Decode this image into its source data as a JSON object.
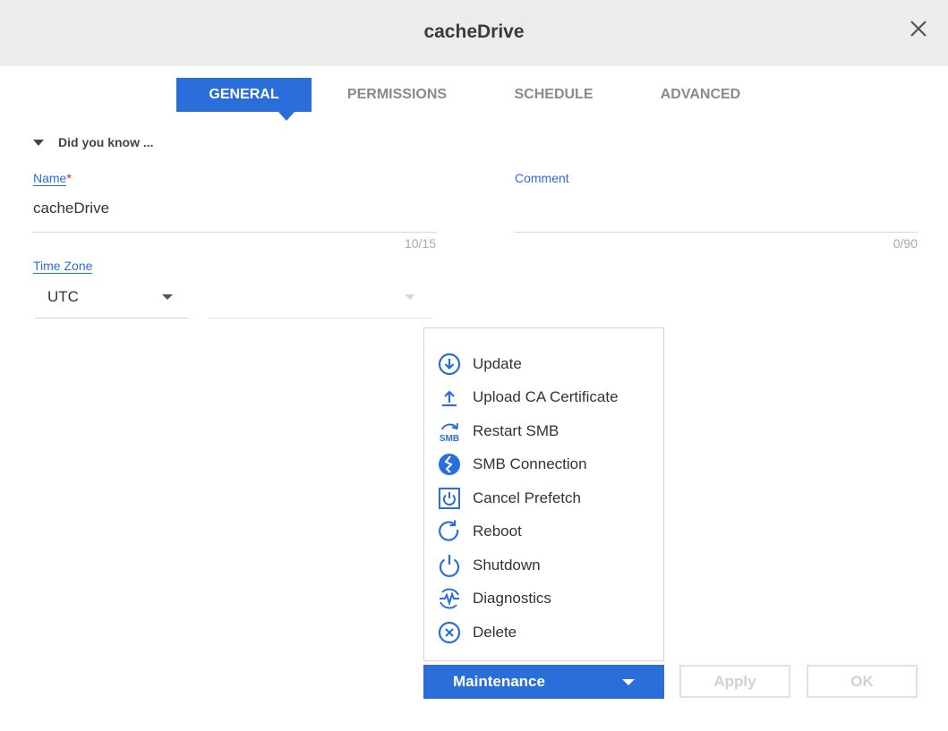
{
  "dialog": {
    "title": "cacheDrive",
    "close_icon": "close-icon"
  },
  "tabs": [
    {
      "label": "GENERAL",
      "active": true
    },
    {
      "label": "PERMISSIONS",
      "active": false
    },
    {
      "label": "SCHEDULE",
      "active": false
    },
    {
      "label": "ADVANCED",
      "active": false
    }
  ],
  "did_you_know": "Did you know ...",
  "form": {
    "name": {
      "label": "Name",
      "required_mark": "*",
      "value": "cacheDrive",
      "counter": "10/15"
    },
    "comment": {
      "label": "Comment",
      "value": "",
      "counter": "0/90"
    },
    "time_zone": {
      "label": "Time Zone",
      "value": "UTC",
      "secondary_value": ""
    }
  },
  "maintenance_menu": {
    "items": [
      {
        "label": "Update",
        "icon": "update-icon"
      },
      {
        "label": "Upload CA Certificate",
        "icon": "upload-icon"
      },
      {
        "label": "Restart SMB",
        "icon": "restart-smb-icon",
        "icon_text": "SMB"
      },
      {
        "label": "SMB Connection",
        "icon": "smb-connection-icon"
      },
      {
        "label": "Cancel Prefetch",
        "icon": "cancel-prefetch-icon"
      },
      {
        "label": "Reboot",
        "icon": "reboot-icon"
      },
      {
        "label": "Shutdown",
        "icon": "shutdown-icon"
      },
      {
        "label": "Diagnostics",
        "icon": "diagnostics-icon"
      },
      {
        "label": "Delete",
        "icon": "delete-icon"
      }
    ]
  },
  "buttons": {
    "maintenance": "Maintenance",
    "apply": "Apply",
    "ok": "OK"
  },
  "colors": {
    "accent": "#2a6edc",
    "title_bar": "#ececec",
    "required": "#e02020",
    "disabled": "#d0d0d0"
  }
}
